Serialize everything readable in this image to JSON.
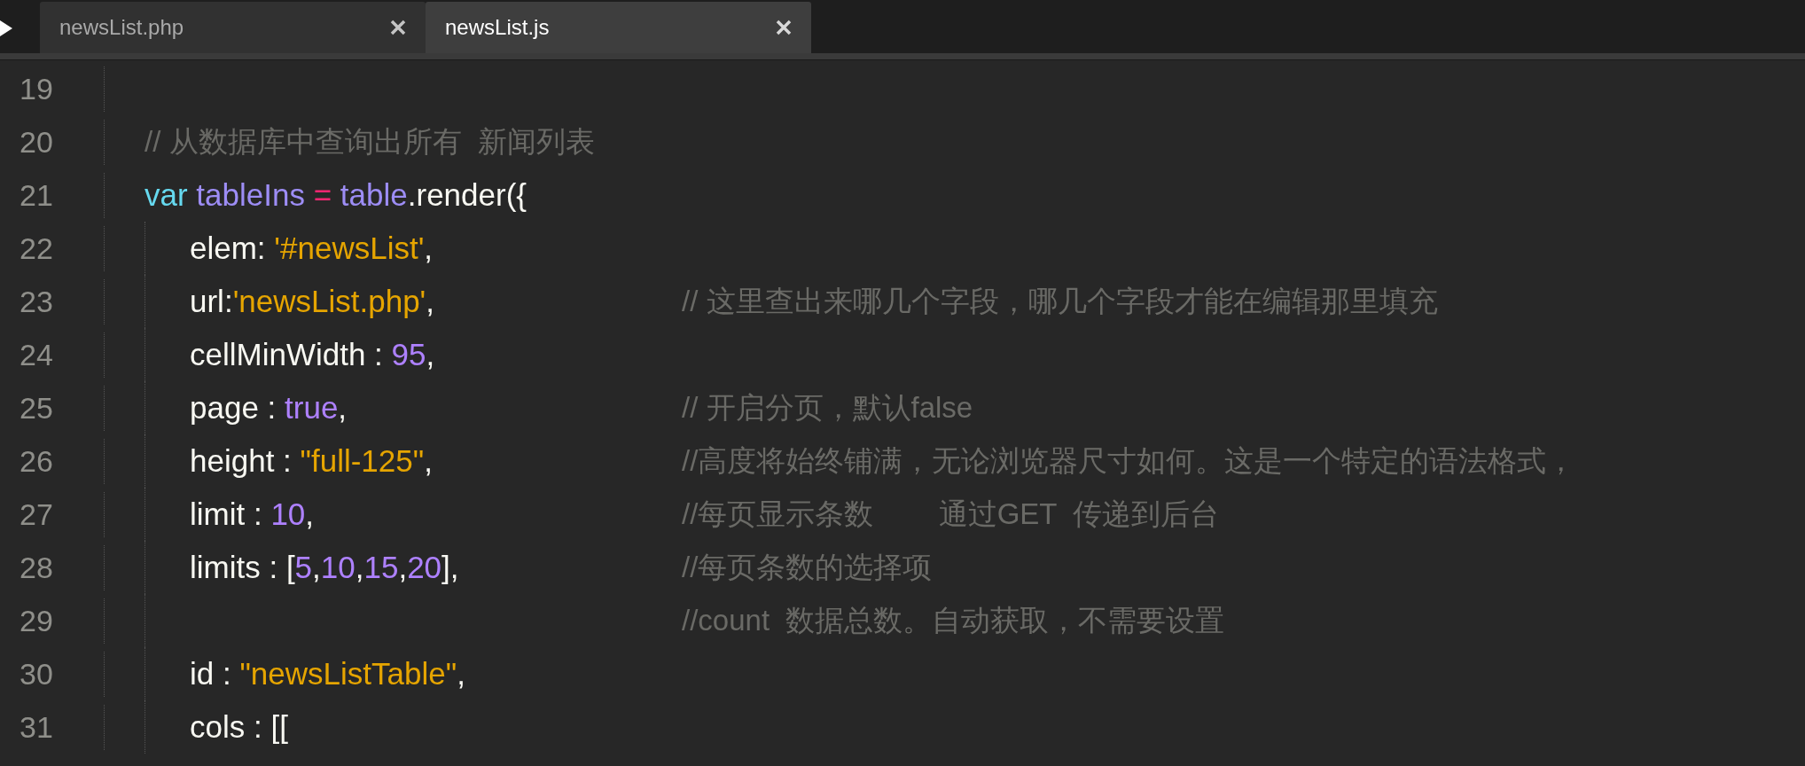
{
  "tabs": [
    {
      "label": "newsList.php",
      "selected": false
    },
    {
      "label": "newsList.js",
      "selected": true
    }
  ],
  "lines": [
    {
      "number": "19"
    },
    {
      "number": "20",
      "comment": "// 从数据库中查询出所有  新闻列表"
    },
    {
      "number": "21",
      "tokens": [
        {
          "kind": "keyword",
          "text": "var "
        },
        {
          "kind": "variable",
          "text": "tableIns "
        },
        {
          "kind": "operator",
          "text": "= "
        },
        {
          "kind": "variable",
          "text": "table"
        },
        {
          "kind": "plain",
          "text": ".render({"
        }
      ],
      "children": [
        {
          "number": "22",
          "tokens": [
            {
              "kind": "plain",
              "text": "elem: "
            },
            {
              "kind": "string",
              "text": "'#newsList'"
            },
            {
              "kind": "plain",
              "text": ","
            }
          ]
        },
        {
          "number": "23",
          "tokens": [
            {
              "kind": "plain",
              "text": "url:"
            },
            {
              "kind": "string",
              "text": "'newsList.php'"
            },
            {
              "kind": "plain",
              "text": ","
            }
          ],
          "comment": "// 这里查出来哪几个字段，哪几个字段才能在编辑那里填充"
        },
        {
          "number": "24",
          "tokens": [
            {
              "kind": "plain",
              "text": "cellMinWidth : "
            },
            {
              "kind": "number",
              "text": "95"
            },
            {
              "kind": "plain",
              "text": ","
            }
          ]
        },
        {
          "number": "25",
          "tokens": [
            {
              "kind": "plain",
              "text": "page : "
            },
            {
              "kind": "number",
              "text": "true"
            },
            {
              "kind": "plain",
              "text": ","
            }
          ],
          "comment": "// 开启分页，默认false"
        },
        {
          "number": "26",
          "tokens": [
            {
              "kind": "plain",
              "text": "height : "
            },
            {
              "kind": "string",
              "text": "\"full-125\""
            },
            {
              "kind": "plain",
              "text": ","
            }
          ],
          "comment": "//高度将始终铺满，无论浏览器尺寸如何。这是一个特定的语法格式，"
        },
        {
          "number": "27",
          "tokens": [
            {
              "kind": "plain",
              "text": "limit : "
            },
            {
              "kind": "number",
              "text": "10"
            },
            {
              "kind": "plain",
              "text": ","
            }
          ],
          "comment": "//每页显示条数        通过GET  传递到后台"
        },
        {
          "number": "28",
          "tokens": [
            {
              "kind": "plain",
              "text": "limits : ["
            },
            {
              "kind": "number",
              "text": "5"
            },
            {
              "kind": "plain",
              "text": ","
            },
            {
              "kind": "number",
              "text": "10"
            },
            {
              "kind": "plain",
              "text": ","
            },
            {
              "kind": "number",
              "text": "15"
            },
            {
              "kind": "plain",
              "text": ","
            },
            {
              "kind": "number",
              "text": "20"
            },
            {
              "kind": "plain",
              "text": "],"
            }
          ],
          "comment": "//每页条数的选择项"
        },
        {
          "number": "29",
          "comment": "//count  数据总数。自动获取，不需要设置"
        },
        {
          "number": "30",
          "tokens": [
            {
              "kind": "plain",
              "text": "id : "
            },
            {
              "kind": "string",
              "text": "\"newsListTable\""
            },
            {
              "kind": "plain",
              "text": ","
            }
          ]
        },
        {
          "number": "31",
          "tokens": [
            {
              "kind": "plain",
              "text": "cols : [["
            }
          ]
        }
      ]
    }
  ]
}
